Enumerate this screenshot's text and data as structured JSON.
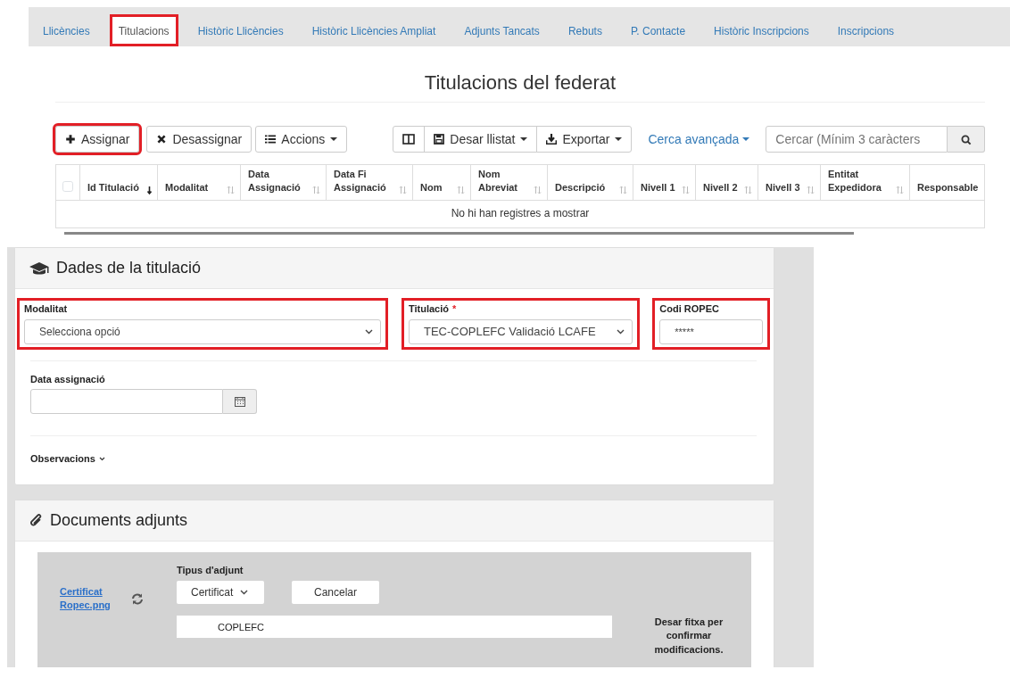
{
  "tabs": [
    {
      "label": "Llicències",
      "selected": false,
      "highlighted": false
    },
    {
      "label": "Titulacions",
      "selected": true,
      "highlighted": true
    },
    {
      "label": "Històric Llicències",
      "selected": false,
      "highlighted": false
    },
    {
      "label": "Històric Llicències Ampliat",
      "selected": false,
      "highlighted": false
    },
    {
      "label": "Adjunts Tancats",
      "selected": false,
      "highlighted": false
    },
    {
      "label": "Rebuts",
      "selected": false,
      "highlighted": false
    },
    {
      "label": "P. Contacte",
      "selected": false,
      "highlighted": false
    },
    {
      "label": "Històric Inscripcions",
      "selected": false,
      "highlighted": false
    },
    {
      "label": "Inscripcions",
      "selected": false,
      "highlighted": false
    }
  ],
  "page_title": "Titulacions del federat",
  "toolbar": {
    "left_buttons": [
      {
        "label": "Assignar",
        "caret": false,
        "highlighted": true
      },
      {
        "label": "Desassignar",
        "caret": false,
        "highlighted": false
      },
      {
        "label": "Accions",
        "caret": true,
        "highlighted": false
      }
    ],
    "right_buttons": [
      {
        "label": "Desar llistat",
        "caret": true
      },
      {
        "label": "Exportar",
        "caret": true
      }
    ],
    "advanced_search": "Cerca avançada",
    "search": {
      "placeholder": "Cercar (Mínim 3 caràcters"
    }
  },
  "table": {
    "select_all_checked": false,
    "columns": [
      {
        "label": "Id Titulació",
        "sorted": true
      },
      {
        "label": "Modalitat",
        "sorted": false
      },
      {
        "label": "Data Assignació",
        "sorted": false
      },
      {
        "label": "Data Fi Assignació",
        "sorted": false
      },
      {
        "label": "Nom",
        "sorted": false
      },
      {
        "label": "Nom Abreviat",
        "sorted": false
      },
      {
        "label": "Descripció",
        "sorted": false
      },
      {
        "label": "Nivell 1",
        "sorted": false
      },
      {
        "label": "Nivell 2",
        "sorted": false
      },
      {
        "label": "Nivell 3",
        "sorted": false
      },
      {
        "label": "Entitat Expedidora",
        "sorted": false
      },
      {
        "label": "Responsable"
      }
    ],
    "empty_message": "No hi han registres a mostrar"
  },
  "details_panel": {
    "title": "Dades de la titulació",
    "fields": [
      {
        "kind": "select",
        "label": "Modalitat",
        "value": "Selecciona opció",
        "highlighted": true
      },
      {
        "kind": "select",
        "label": "Titulació",
        "required_mark": "*",
        "value": "TEC-COPLEFC Validació LCAFE",
        "highlighted": true
      },
      {
        "kind": "text",
        "label": "Codi ROPEC",
        "value": "*****",
        "highlighted": true
      }
    ],
    "date_field": {
      "label": "Data assignació"
    },
    "observations": {
      "label": "Observacions",
      "expanded": false
    }
  },
  "documents_panel": {
    "title": "Documents adjunts",
    "file_link": "Certificat Ropec.png",
    "type_label": "Tipus d'adjunt",
    "type_value": "Certificat",
    "cancel_button": "Cancelar",
    "description": "COPLEFC",
    "save_note": "Desar fitxa per confirmar modificacions."
  }
}
